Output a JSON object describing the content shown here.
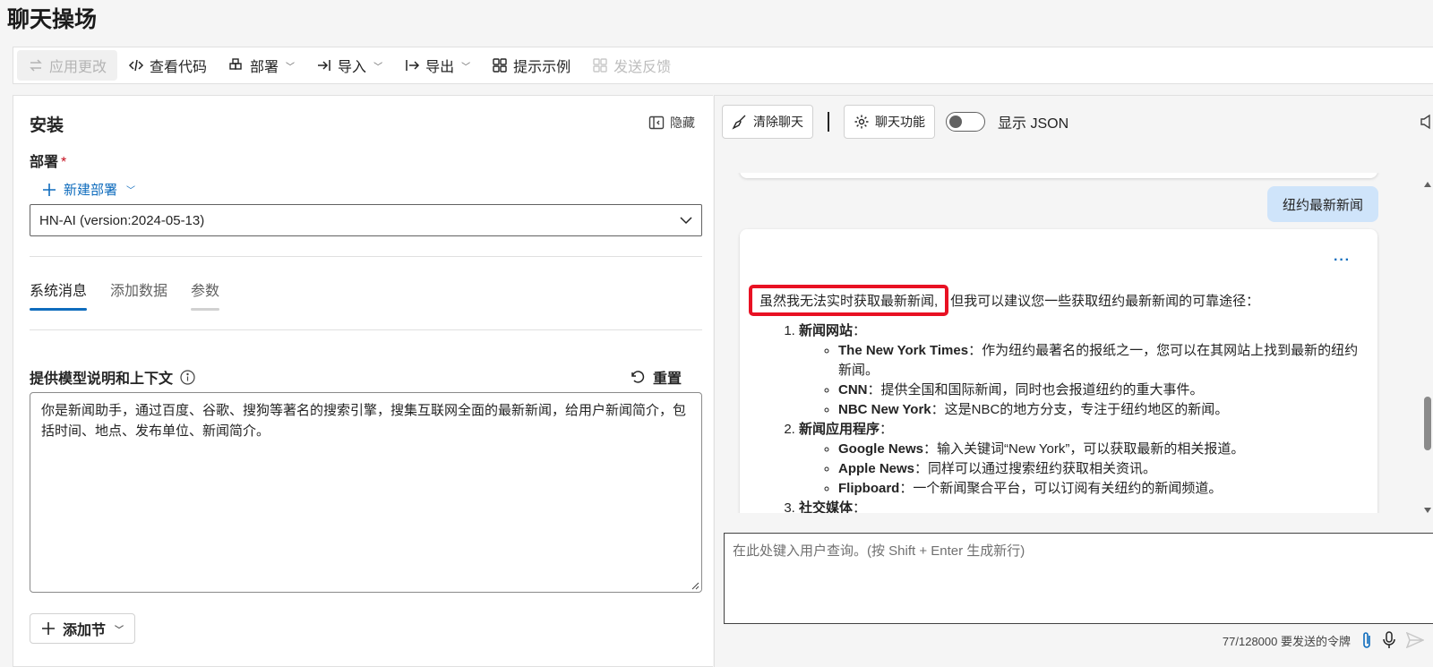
{
  "page": {
    "title": "聊天操场"
  },
  "toolbar": {
    "apply_changes": "应用更改",
    "view_code": "查看代码",
    "deploy": "部署",
    "import": "导入",
    "export": "导出",
    "prompt_samples": "提示示例",
    "send_feedback": "发送反馈"
  },
  "setup": {
    "title": "安装",
    "hide_label": "隐藏",
    "deployment_label": "部署",
    "required_mark": "*",
    "new_deployment": "新建部署",
    "deployment_value": "HN-AI (version:2024-05-13)",
    "tabs": [
      {
        "label": "系统消息"
      },
      {
        "label": "添加数据"
      },
      {
        "label": "参数"
      }
    ],
    "context_label": "提供模型说明和上下文",
    "reset_label": "重置",
    "system_message": "你是新闻助手，通过百度、谷歌、搜狗等著名的搜索引擎，搜集互联网全面的最新新闻，给用户新闻简介，包括时间、地点、发布单位、新闻简介。",
    "add_section": "添加节"
  },
  "chat": {
    "clear_chat": "清除聊天",
    "chat_features": "聊天功能",
    "show_json": "显示 JSON",
    "user_message": "纽约最新新闻",
    "more_label": "···",
    "reply_highlight": "虽然我无法实时获取最新新闻,",
    "reply_intro_rest": "但我可以建议您一些获取纽约最新新闻的可靠途径：",
    "sections": [
      {
        "title": "新闻网站",
        "items": [
          {
            "name": "The New York Times",
            "desc": "：作为纽约最著名的报纸之一，您可以在其网站上找到最新的纽约新闻。"
          },
          {
            "name": "CNN",
            "desc": "：提供全国和国际新闻，同时也会报道纽约的重大事件。"
          },
          {
            "name": "NBC New York",
            "desc": "：这是NBC的地方分支，专注于纽约地区的新闻。"
          }
        ]
      },
      {
        "title": "新闻应用程序",
        "items": [
          {
            "name": "Google News",
            "desc": "：输入关键词“New York”，可以获取最新的相关报道。"
          },
          {
            "name": "Apple News",
            "desc": "：同样可以通过搜索纽约获取相关资讯。"
          },
          {
            "name": "Flipboard",
            "desc": "：一个新闻聚合平台，可以订阅有关纽约的新闻频道。"
          }
        ]
      },
      {
        "title": "社交媒体",
        "items": []
      }
    ],
    "input_placeholder": "在此处键入用户查询。(按 Shift + Enter 生成新行)",
    "token_count": "77/128000 要发送的令牌"
  }
}
